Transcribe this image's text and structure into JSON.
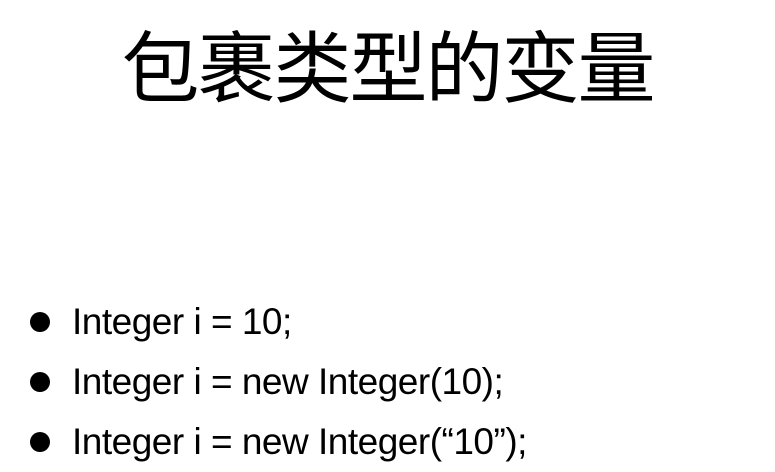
{
  "slide": {
    "title": "包裹类型的变量",
    "bullets": [
      "Integer i = 10;",
      "Integer i = new Integer(10);",
      "Integer i = new Integer(“10”);"
    ]
  }
}
